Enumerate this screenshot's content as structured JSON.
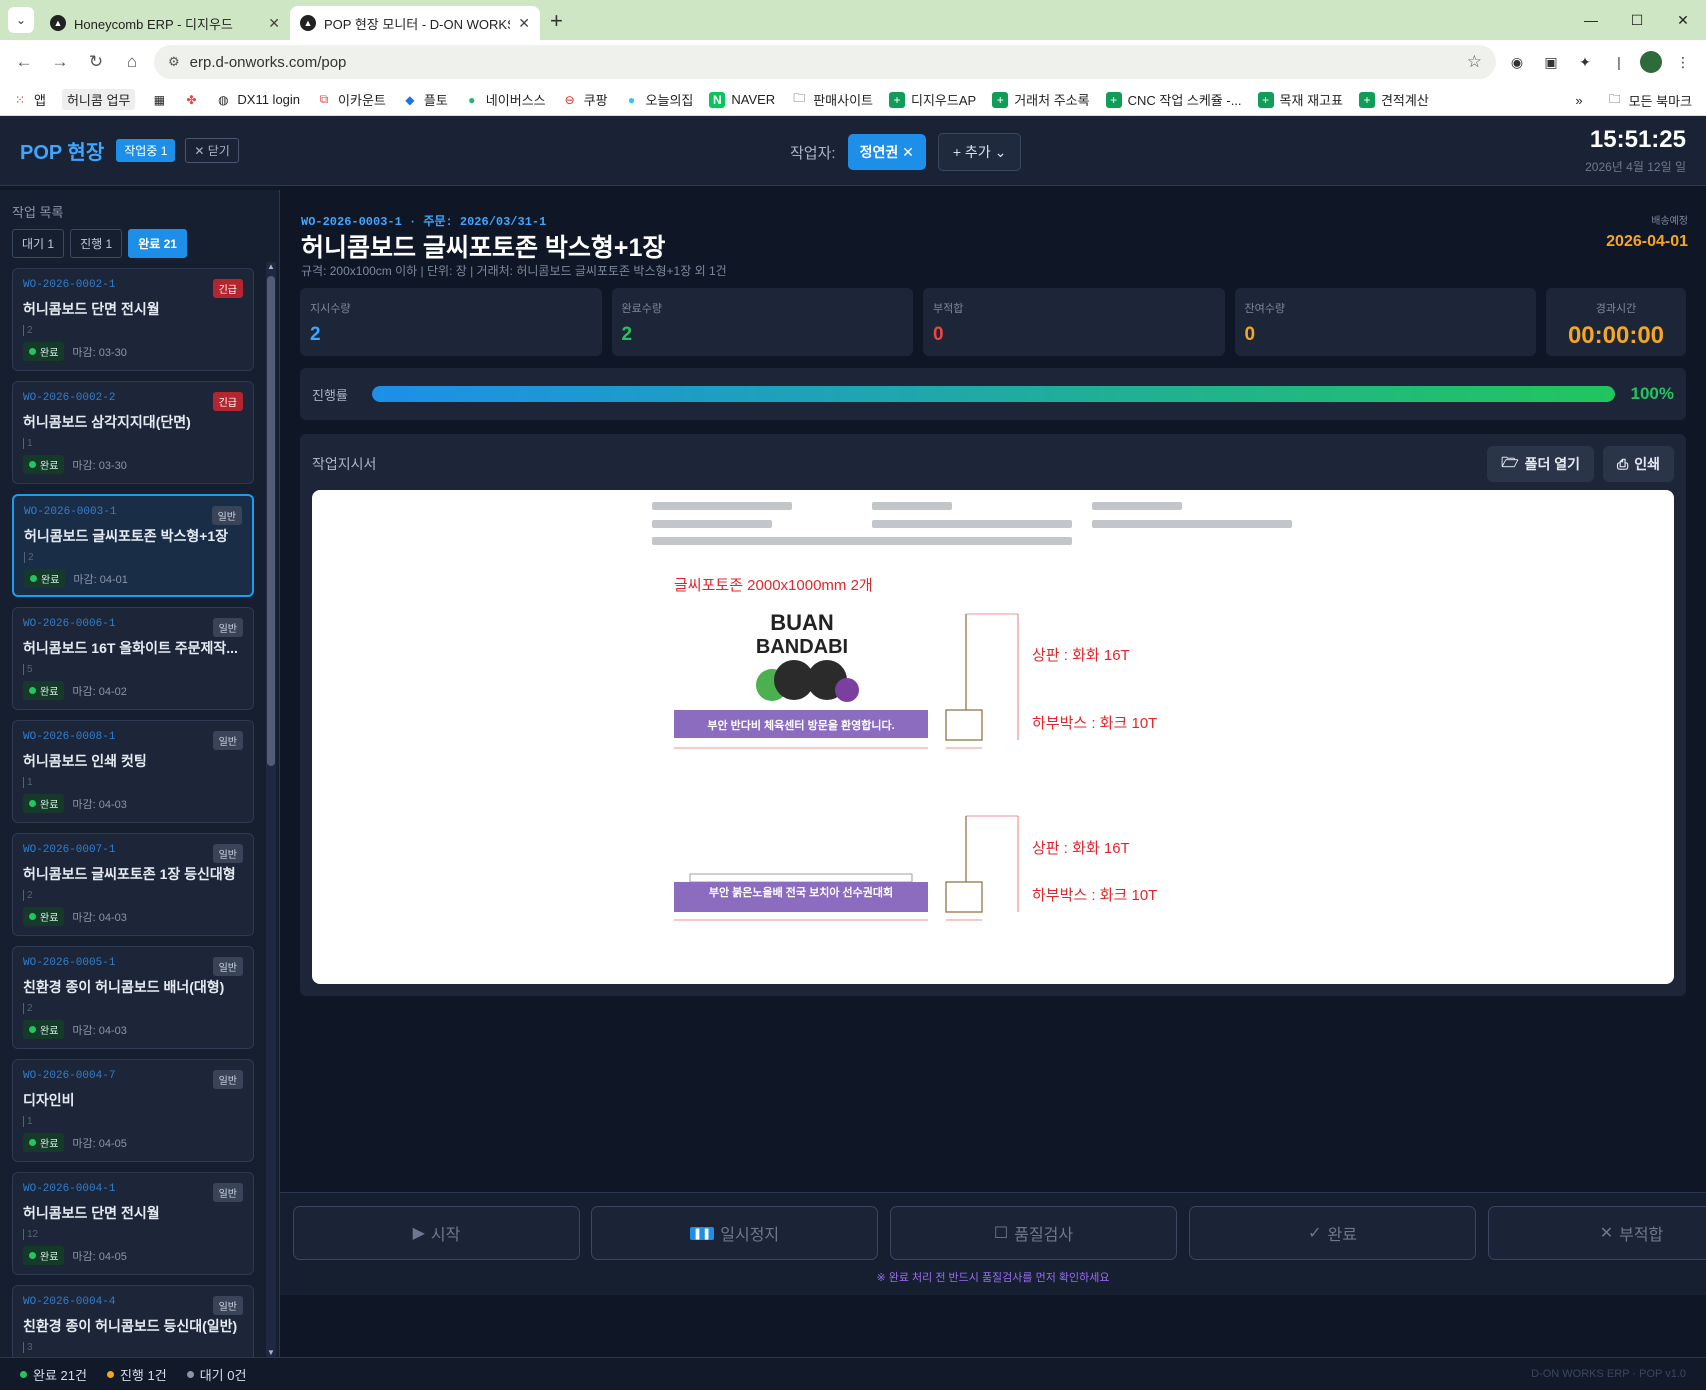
{
  "browser": {
    "tabs": [
      {
        "title": "Honeycomb ERP - 디지우드",
        "active": false
      },
      {
        "title": "POP 현장 모니터 - D-ON WORKS",
        "active": true
      }
    ],
    "url": "erp.d-onworks.com/pop",
    "bookmarks": [
      {
        "label": "앱",
        "icon": "apps-grid-icon"
      },
      {
        "label": "허니콤 업무",
        "icon": ""
      },
      {
        "label": "",
        "icon": "grid-icon"
      },
      {
        "label": "",
        "icon": "pinwheel-icon"
      },
      {
        "label": "DX11 login",
        "icon": "globe-icon"
      },
      {
        "label": "이카운트",
        "icon": "ecount-icon"
      },
      {
        "label": "플토",
        "icon": "plto-icon"
      },
      {
        "label": "네이버스스",
        "icon": "naver-ss-icon"
      },
      {
        "label": "쿠팡",
        "icon": "coupang-icon"
      },
      {
        "label": "오늘의집",
        "icon": "ohouse-icon"
      },
      {
        "label": "NAVER",
        "icon": "naver-icon"
      },
      {
        "label": "판매사이트",
        "icon": "folder-icon"
      },
      {
        "label": "디지우드AP",
        "icon": "sheets-icon"
      },
      {
        "label": "거래처 주소록",
        "icon": "sheets-icon"
      },
      {
        "label": "CNC 작업 스케쥴 -...",
        "icon": "sheets-icon"
      },
      {
        "label": "목재 재고표",
        "icon": "sheets-icon"
      },
      {
        "label": "견적계산",
        "icon": "sheets-icon"
      }
    ],
    "bookmarks_more": "»",
    "all_bookmarks": "모든 북마크"
  },
  "header": {
    "brand": "POP 현장",
    "working_badge": "작업중 1",
    "close_label": "닫기",
    "worker_label": "작업자:",
    "worker_name": "정연권",
    "add_worker": "+ 추가",
    "time": "15:51:25",
    "date": "2026년 4월 12일 일"
  },
  "sidebar": {
    "title": "작업 목록",
    "filters": [
      {
        "label": "대기 1",
        "active": false
      },
      {
        "label": "진행 1",
        "active": false
      },
      {
        "label": "완료 21",
        "active": true
      }
    ],
    "cards": [
      {
        "code": "WO-2026-0002-1",
        "priority": "긴급",
        "urgent": true,
        "name": "허니콤보드 단면 전시월",
        "qty": "2",
        "status": "완료",
        "due": "마감: 03-30",
        "selected": false
      },
      {
        "code": "WO-2026-0002-2",
        "priority": "긴급",
        "urgent": true,
        "name": "허니콤보드 삼각지지대(단면)",
        "qty": "1",
        "status": "완료",
        "due": "마감: 03-30",
        "selected": false
      },
      {
        "code": "WO-2026-0003-1",
        "priority": "일반",
        "urgent": false,
        "name": "허니콤보드 글씨포토존 박스형+1장",
        "qty": "2",
        "status": "완료",
        "due": "마감: 04-01",
        "selected": true
      },
      {
        "code": "WO-2026-0006-1",
        "priority": "일반",
        "urgent": false,
        "name": "허니콤보드 16T 올화이트 주문제작...",
        "qty": "5",
        "status": "완료",
        "due": "마감: 04-02",
        "selected": false
      },
      {
        "code": "WO-2026-0008-1",
        "priority": "일반",
        "urgent": false,
        "name": "허니콤보드 인쇄 컷팅",
        "qty": "1",
        "status": "완료",
        "due": "마감: 04-03",
        "selected": false
      },
      {
        "code": "WO-2026-0007-1",
        "priority": "일반",
        "urgent": false,
        "name": "허니콤보드 글씨포토존 1장 등신대형",
        "qty": "2",
        "status": "완료",
        "due": "마감: 04-03",
        "selected": false
      },
      {
        "code": "WO-2026-0005-1",
        "priority": "일반",
        "urgent": false,
        "name": "친환경 종이 허니콤보드 배너(대형)",
        "qty": "2",
        "status": "완료",
        "due": "마감: 04-03",
        "selected": false
      },
      {
        "code": "WO-2026-0004-7",
        "priority": "일반",
        "urgent": false,
        "name": "디자인비",
        "qty": "1",
        "status": "완료",
        "due": "마감: 04-05",
        "selected": false
      },
      {
        "code": "WO-2026-0004-1",
        "priority": "일반",
        "urgent": false,
        "name": "허니콤보드 단면 전시월",
        "qty": "12",
        "status": "완료",
        "due": "마감: 04-05",
        "selected": false
      },
      {
        "code": "WO-2026-0004-4",
        "priority": "일반",
        "urgent": false,
        "name": "친환경 종이 허니콤보드 등신대(일반)",
        "qty": "3",
        "status": "완료",
        "due": "마감: 04-05",
        "selected": false
      }
    ]
  },
  "order": {
    "meta": "WO-2026-0003-1 · 주문: 2026/03/31-1",
    "title": "허니콤보드 글씨포토존 박스형+1장",
    "spec": "규격: 200x100cm 이하 | 단위: 장 | 거래처: 허니콤보드 글씨포토존 박스형+1장 외 1건",
    "ship_label": "배송예정",
    "ship_date": "2026-04-01",
    "stats": {
      "ordered_label": "지시수량",
      "ordered": "2",
      "completed_label": "완료수량",
      "completed": "2",
      "defect_label": "부적합",
      "defect": "0",
      "remaining_label": "잔여수량",
      "remaining": "0",
      "elapsed_label": "경과시간",
      "elapsed": "00:00:00"
    },
    "progress_label": "진행률",
    "progress_percent": 100,
    "progress_text": "100%",
    "stat_colors": {
      "ordered": "#3ea6ff",
      "completed": "#22c55e",
      "defect": "#ef4444",
      "remaining": "#f5a623"
    }
  },
  "instruction": {
    "label": "작업지시서",
    "folder_button": "폴더 열기",
    "print_button": "인쇄",
    "sheet": {
      "heading": "글씨포토존 2000x1000mm 2개",
      "logo_line1": "BUAN",
      "logo_line2": "BANDABI",
      "banner1": "부안 반다비 체육센터 방문을 환영합니다.",
      "banner2": "부안 붉은노을배 전국 보치아 선수권대회",
      "top_label": "상판 : 화화 16T",
      "box_label": "하부박스 : 화크 10T"
    }
  },
  "actions": {
    "start": "시작",
    "pause": "일시정지",
    "quality": "품질검사",
    "complete": "완료",
    "defect": "부적합",
    "note": "※ 완료 처리 전 반드시 품질검사를 먼저 확인하세요"
  },
  "statusbar": {
    "done": "완료 21건",
    "in_progress": "진행 1건",
    "waiting": "대기 0건",
    "footer": "D-ON WORKS ERP · POP v1.0"
  }
}
